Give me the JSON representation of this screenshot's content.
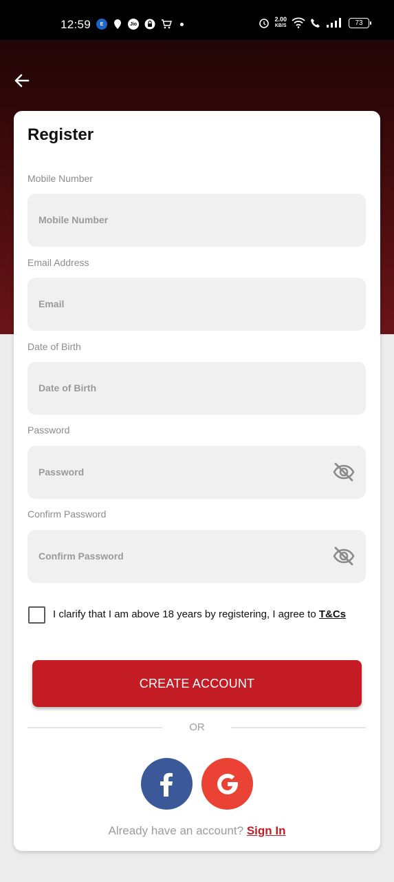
{
  "status_bar": {
    "time": "12:59",
    "speed_value": "2.00",
    "speed_unit": "KB/S",
    "battery": "73",
    "left_icons": [
      "e-icon",
      "location-icon",
      "jio-icon",
      "lock-icon",
      "cart-icon",
      "dot-icon"
    ],
    "right_icons": [
      "alarm-icon",
      "wifi-icon",
      "call-icon",
      "signal-icon",
      "battery-icon"
    ]
  },
  "header": {
    "back_icon": "arrow-left-icon"
  },
  "form": {
    "title": "Register",
    "fields": [
      {
        "label": "Mobile Number",
        "placeholder": "Mobile Number",
        "value": ""
      },
      {
        "label": "Email Address",
        "placeholder": "Email",
        "value": ""
      },
      {
        "label": "Date of Birth",
        "placeholder": "Date of Birth",
        "value": ""
      },
      {
        "label": "Password",
        "placeholder": "Password",
        "value": "",
        "icon": "eye-off-icon"
      },
      {
        "label": "Confirm Password",
        "placeholder": "Confirm Password",
        "value": "",
        "icon": "eye-off-icon"
      }
    ],
    "agreement": {
      "text": "I clarify that I am above 18 years by registering, I agree to ",
      "link": "T&Cs",
      "checked": false
    },
    "submit_label": "CREATE ACCOUNT",
    "or_text": "OR",
    "social": [
      {
        "name": "facebook",
        "glyph": "f",
        "color": "#3b5998"
      },
      {
        "name": "google",
        "glyph": "G",
        "color": "#ea4335"
      }
    ],
    "signin_prompt": "Already have an account? ",
    "signin_link": "Sign In"
  },
  "colors": {
    "accent": "#c41c24",
    "hero_top": "#210506",
    "hero_bottom": "#6a1418",
    "field_bg": "#f0f0f0"
  }
}
